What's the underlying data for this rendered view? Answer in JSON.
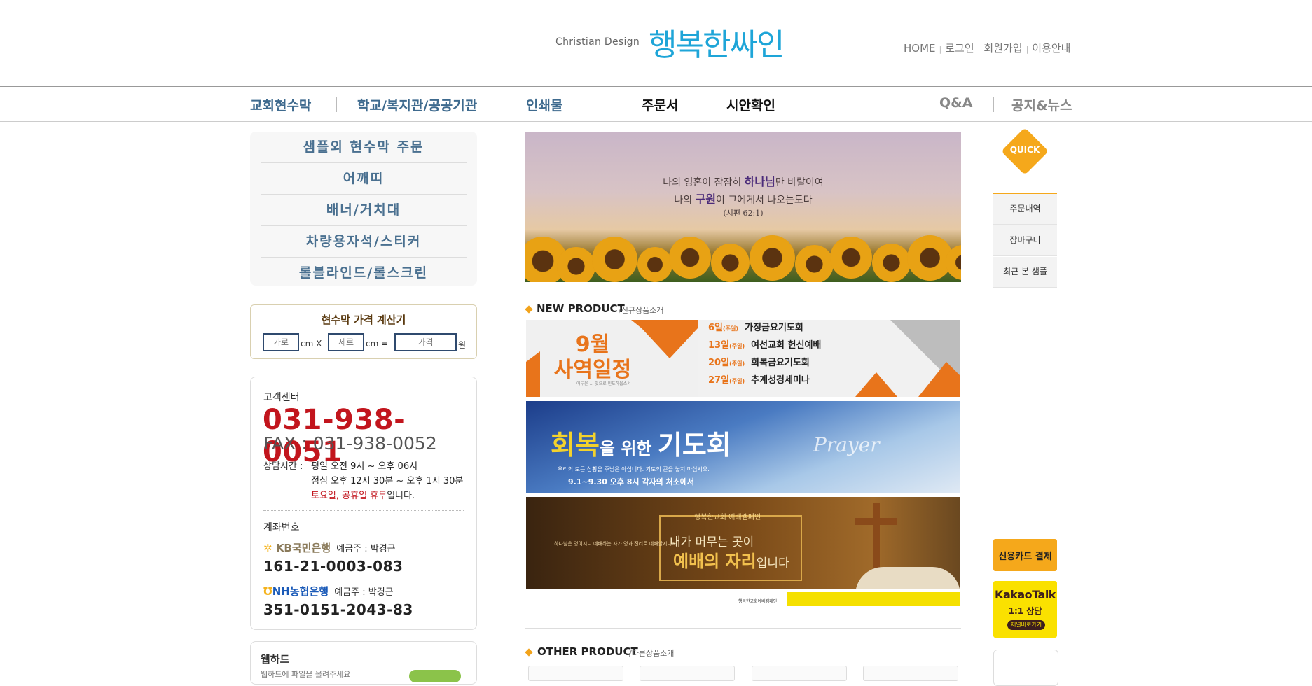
{
  "header": {
    "brand_sub": "Christian Design",
    "brand_main": "행복한싸인",
    "top_links": [
      "HOME",
      "로그인",
      "회원가입",
      "이용안내"
    ]
  },
  "gnb": {
    "items": [
      "교회현수막",
      "학교/복지관/공공기관",
      "인쇄물",
      "주문서",
      "시안확인",
      "Q&A",
      "공지&뉴스"
    ]
  },
  "categories": [
    "샘플외 현수막 주문",
    "어깨띠",
    "배너/거치대",
    "차량용자석/스티커",
    "롤블라인드/롤스크린"
  ],
  "calculator": {
    "title": "현수막 가격 계산기",
    "width_placeholder": "가로",
    "height_placeholder": "세로",
    "price_placeholder": "가격",
    "unit_x": "cm X",
    "unit_eq": "cm =",
    "unit_won": "원"
  },
  "customer_center": {
    "label": "고객센터",
    "phone": "031-938-0051",
    "fax": "FAX : 031-938-0052",
    "hours_label": "상담시간 :",
    "hours_weekday": "평일  오전 9시 ~ 오후 06시",
    "hours_lunch": "점심  오후 12시 30분 ~ 오후 1시 30분",
    "holiday_red": "토요일, 공휴일 휴무",
    "holiday_rest": "입니다.",
    "account_label": "계좌번호",
    "bank1_name": "KB국민은행",
    "bank1_holder": "예금주 : 박경근",
    "bank1_account": "161-21-0003-083",
    "bank2_name": "NH농협은행",
    "bank2_holder": "예금주 : 박경근",
    "bank2_account": "351-0151-2043-83"
  },
  "webhard": {
    "title": "웹하드",
    "desc": "웹하드에 파일을 올려주세요"
  },
  "hero": {
    "line1_pre": "나의 영혼이 잠잠히 ",
    "line1_bold": "하나님",
    "line1_post": "만 바랄이여",
    "line2_pre": "나의 ",
    "line2_bold": "구원",
    "line2_post": "이 그에게서 나오는도다",
    "ref": "(시편 62:1)"
  },
  "new_product": {
    "title": "NEW PRODUCT",
    "sub": "/신규상품소개",
    "banner1": {
      "big": "9월\n사역일정",
      "small": "어두운 ... 빛으로 인도하옵소서",
      "events": [
        {
          "date": "6일",
          "day": "(주일)",
          "name": "가정금요기도회"
        },
        {
          "date": "13일",
          "day": "(주일)",
          "name": "여선교회 헌신예배"
        },
        {
          "date": "20일",
          "day": "(주일)",
          "name": "회복금요기도회"
        },
        {
          "date": "27일",
          "day": "(주일)",
          "name": "추계성경세미나"
        }
      ]
    },
    "banner2": {
      "title_a": "회복",
      "title_b": "을 위한 ",
      "title_c": "기도회",
      "prayer": "Prayer",
      "sub": "우리의 모든 상황을 주님은 아십니다. 기도의 끈을 놓지 마십시오.",
      "date": "9.1~9.30 오후 8시  각자의 처소에서"
    },
    "banner3": {
      "top": "행복한교회 예배캠페인",
      "line1": "내가 머무는 곳이",
      "line2_bold": "예배의 자리",
      "line2_rest": "입니다",
      "left": "하나님은 영이시니 예배하는 자가 영과 진리로 예배할지니라"
    },
    "banner4": {
      "text": "행복한교회예배캠페인"
    }
  },
  "other_product": {
    "title": "OTHER PRODUCT",
    "sub": "/다른상품소개"
  },
  "quick": {
    "label": "QUICK",
    "items": [
      "주문내역",
      "장바구니",
      "최근 본 샘플"
    ],
    "card_pay": "신용카드 결제",
    "kakao_title": "KakaoTalk",
    "kakao_sub": "1:1 상담",
    "kakao_btn": "채널바로가기"
  },
  "colors": {
    "brand_blue": "#1ea5d8",
    "phone_red": "#c2151d",
    "accent_orange": "#f5a81b",
    "nav_blue": "#3e6a8e"
  }
}
